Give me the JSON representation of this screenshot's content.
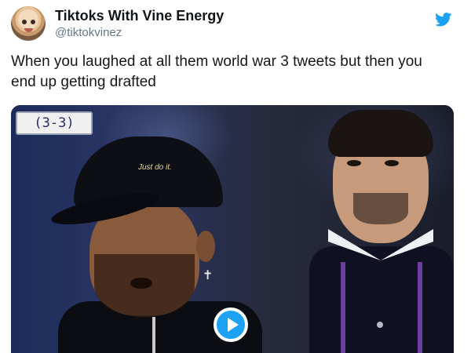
{
  "tweet": {
    "author_name": "Tiktoks With Vine Energy",
    "author_handle": "@tiktokvinez",
    "text": "When you laughed at all them world war 3 tweets but then you end up getting drafted"
  },
  "media": {
    "score_overlay": "(3-3)",
    "cap_logo_text": "Just do it.",
    "type": "video",
    "play_icon": "play-icon"
  },
  "colors": {
    "brand_blue": "#1da1f2",
    "name_text": "#14171a",
    "handle_text": "#657786"
  }
}
